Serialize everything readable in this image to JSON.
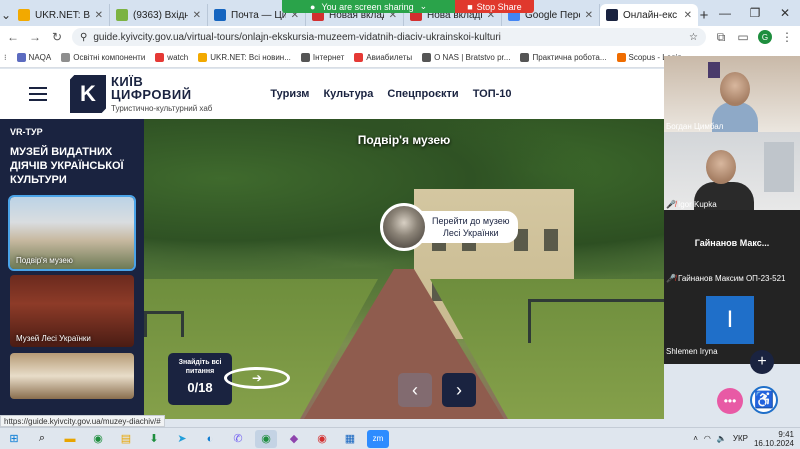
{
  "browser": {
    "tabs": [
      {
        "title": "UKR.NET: Всі но",
        "color": "#f2a900"
      },
      {
        "title": "(9363) Вхідні",
        "color": "#7cb342"
      },
      {
        "title": "Почта — Цит",
        "color": "#1565c0"
      },
      {
        "title": "Новая вкладка",
        "color": "#d32f2f"
      },
      {
        "title": "Нова вкладка",
        "color": "#d32f2f"
      },
      {
        "title": "Google Перевод",
        "color": "#4285f4"
      },
      {
        "title": "Онлайн-екс",
        "color": "#1a2340"
      }
    ],
    "screen_share": {
      "message": "You are screen sharing",
      "stop": "Stop Share"
    },
    "url": "guide.kyivcity.gov.ua/virtual-tours/onlajn-ekskursia-muzeem-vidatnih-diaciv-ukrainskoi-kulturi",
    "profile_letter": "G",
    "bookmarks": [
      {
        "label": "NAQA",
        "color": "#5c6bc0"
      },
      {
        "label": "Освітні компоненти",
        "color": "#8e8e8e"
      },
      {
        "label": "watch",
        "color": "#e53935"
      },
      {
        "label": "UKR.NET: Всі новин...",
        "color": "#f2a900"
      },
      {
        "label": "Інтернет",
        "color": "#555555"
      },
      {
        "label": "Авиабилеты",
        "color": "#e53935"
      },
      {
        "label": "О NAS | Bratstvo pr...",
        "color": "#555555"
      },
      {
        "label": "Практична робота...",
        "color": "#555555"
      },
      {
        "label": "Scopus - Login",
        "color": "#ef6c00"
      }
    ]
  },
  "site": {
    "logo_line1": "КИЇВ",
    "logo_line2": "ЦИФРОВИЙ",
    "logo_sub": "Туристично-культурний хаб",
    "nav": [
      "Туризм",
      "Культура",
      "Спецпроєкти",
      "ТОП-10"
    ]
  },
  "tour": {
    "tag": "VR-ТУР",
    "title": "Музей видатних діячів української культури",
    "thumbs": [
      {
        "caption": "Подвір'я музею"
      },
      {
        "caption": "Музей Лесі Українки"
      },
      {
        "caption": ""
      }
    ],
    "scene_title": "Подвір'я музею",
    "hotspot_label_line1": "Перейти до музею",
    "hotspot_label_line2": "Лесі Українки",
    "quiz_label": "Знайдіть всі питання",
    "quiz_count": "0/18"
  },
  "zoom": {
    "participants": [
      {
        "name": "Богдан Цимбал",
        "muted": false
      },
      {
        "name": "Igor Kupka",
        "muted": true
      },
      {
        "name": "Гайнанов Максим ОП-23-521",
        "display": "Гайнанов Макс...",
        "muted": true
      },
      {
        "name": "Shlemen Iryna",
        "initial": "I",
        "muted": false
      }
    ]
  },
  "status_url": "https://guide.kyivcity.gov.ua/muzey-diachiv/#",
  "taskbar": {
    "language": "УКР",
    "time": "9:41",
    "date": "16.10.2024"
  }
}
